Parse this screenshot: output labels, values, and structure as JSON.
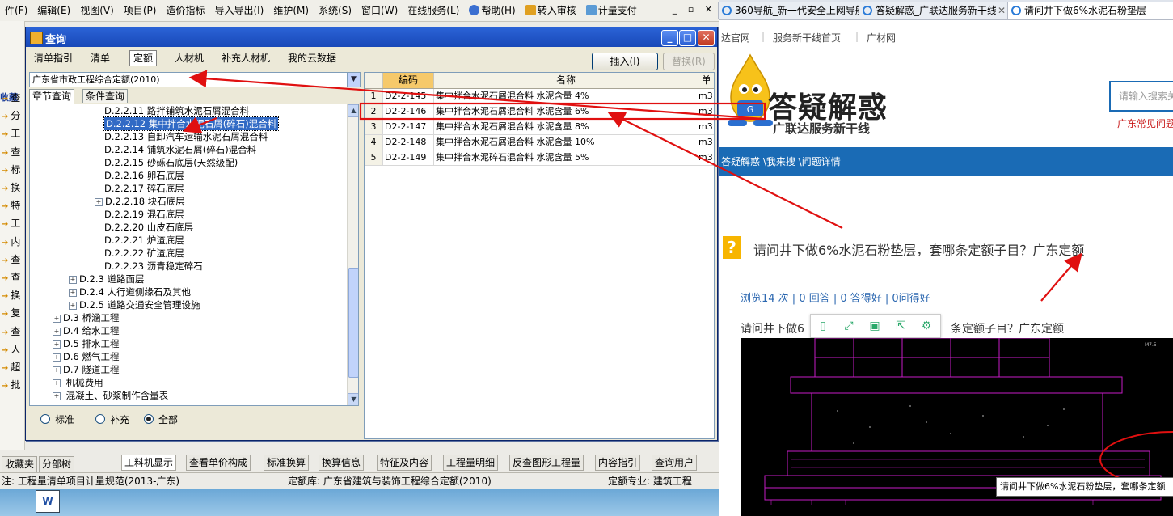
{
  "menubar": {
    "items": [
      "件(F)",
      "编辑(E)",
      "视图(V)",
      "项目(P)",
      "造价指标",
      "导入导出(I)",
      "维护(M)",
      "系统(S)",
      "窗口(W)",
      "在线服务(L)"
    ],
    "help": "帮助(H)",
    "transfer_review": "转入审核",
    "measure_pay": "计量支付",
    "window_controls": "_ ▫ ✕"
  },
  "left_strip": {
    "header": "收藏",
    "rows": [
      "查",
      "分",
      "工",
      "查",
      "标",
      "换",
      "特",
      "工",
      "内",
      "查",
      "查",
      "换",
      "复",
      "查",
      "人",
      "超",
      "批"
    ]
  },
  "dialog": {
    "title": "查询",
    "tabs": [
      "清单指引",
      "清单",
      "定额",
      "人材机",
      "补充人材机",
      "我的云数据"
    ],
    "active_tab": "定额",
    "insert_label": "插入(I)",
    "replace_label": "替换(R)",
    "quota_library": "广东省市政工程综合定额(2010)",
    "subtabs": [
      "章节查询",
      "条件查询"
    ],
    "tree": [
      {
        "code": "D.2.2.11",
        "name": "路拌铺筑水泥石屑混合料",
        "level": 4,
        "expander": false,
        "selected": false
      },
      {
        "code": "D.2.2.12",
        "name": "集中拌合水泥石屑(碎石)混合料",
        "level": 4,
        "expander": false,
        "selected": true
      },
      {
        "code": "D.2.2.13",
        "name": "自卸汽车运输水泥石屑混合料",
        "level": 4,
        "expander": false,
        "selected": false
      },
      {
        "code": "D.2.2.14",
        "name": "铺筑水泥石屑(碎石)混合料",
        "level": 4,
        "expander": false,
        "selected": false
      },
      {
        "code": "D.2.2.15",
        "name": "砂砾石底层(天然级配)",
        "level": 4,
        "expander": false,
        "selected": false
      },
      {
        "code": "D.2.2.16",
        "name": "卵石底层",
        "level": 4,
        "expander": false,
        "selected": false
      },
      {
        "code": "D.2.2.17",
        "name": "碎石底层",
        "level": 4,
        "expander": false,
        "selected": false
      },
      {
        "code": "D.2.2.18",
        "name": "块石底层",
        "level": 4,
        "expander": true,
        "selected": false
      },
      {
        "code": "D.2.2.19",
        "name": "混石底层",
        "level": 4,
        "expander": false,
        "selected": false
      },
      {
        "code": "D.2.2.20",
        "name": "山皮石底层",
        "level": 4,
        "expander": false,
        "selected": false
      },
      {
        "code": "D.2.2.21",
        "name": "炉渣底层",
        "level": 4,
        "expander": false,
        "selected": false
      },
      {
        "code": "D.2.2.22",
        "name": "矿渣底层",
        "level": 4,
        "expander": false,
        "selected": false
      },
      {
        "code": "D.2.2.23",
        "name": "沥青稳定碎石",
        "level": 4,
        "expander": false,
        "selected": false
      },
      {
        "code": "D.2.3",
        "name": "道路面层",
        "level": 2,
        "expander": true,
        "selected": false
      },
      {
        "code": "D.2.4",
        "name": "人行道侧缘石及其他",
        "level": 2,
        "expander": true,
        "selected": false
      },
      {
        "code": "D.2.5",
        "name": "道路交通安全管理设施",
        "level": 2,
        "expander": true,
        "selected": false
      },
      {
        "code": "D.3",
        "name": "桥涵工程",
        "level": 1,
        "expander": true,
        "selected": false
      },
      {
        "code": "D.4",
        "name": "给水工程",
        "level": 1,
        "expander": true,
        "selected": false
      },
      {
        "code": "D.5",
        "name": "排水工程",
        "level": 1,
        "expander": true,
        "selected": false
      },
      {
        "code": "D.6",
        "name": "燃气工程",
        "level": 1,
        "expander": true,
        "selected": false
      },
      {
        "code": "D.7",
        "name": "隧道工程",
        "level": 1,
        "expander": true,
        "selected": false
      },
      {
        "code": "",
        "name": "机械费用",
        "level": 1,
        "expander": true,
        "selected": false
      },
      {
        "code": "",
        "name": "混凝土、砂浆制作含量表",
        "level": 1,
        "expander": true,
        "selected": false
      }
    ],
    "radios": [
      {
        "label": "标准",
        "checked": false
      },
      {
        "label": "补充",
        "checked": false
      },
      {
        "label": "全部",
        "checked": true
      }
    ],
    "grid": {
      "columns": [
        "",
        "编码",
        "名称",
        "单"
      ],
      "rows": [
        {
          "n": "1",
          "code": "D2-2-145",
          "name": "集中拌合水泥石屑混合料 水泥含量 4%",
          "unit": "m3"
        },
        {
          "n": "2",
          "code": "D2-2-146",
          "name": "集中拌合水泥石屑混合料 水泥含量 6%",
          "unit": "m3"
        },
        {
          "n": "3",
          "code": "D2-2-147",
          "name": "集中拌合水泥石屑混合料 水泥含量 8%",
          "unit": "m3"
        },
        {
          "n": "4",
          "code": "D2-2-148",
          "name": "集中拌合水泥石屑混合料 水泥含量 10%",
          "unit": "m3"
        },
        {
          "n": "5",
          "code": "D2-2-149",
          "name": "集中拌合水泥碎石混合料 水泥含量 5%",
          "unit": "m3"
        }
      ]
    }
  },
  "bottom_tabs": {
    "left": [
      "收藏夹",
      "分部树"
    ],
    "right": [
      "工料机显示",
      "查看单价构成",
      "标准换算",
      "换算信息",
      "特征及内容",
      "工程量明细",
      "反查图形工程量",
      "内容指引",
      "查询用户"
    ]
  },
  "status": {
    "spec": "注: 工程量清单项目计量规范(2013-广东)",
    "library": "定额库: 广东省建筑与装饰工程综合定额(2010)",
    "major": "定额专业: 建筑工程"
  },
  "desktop_icon": "W",
  "browser": {
    "tabs": [
      {
        "label": "360导航_新一代安全上网导航",
        "active": false
      },
      {
        "label": "答疑解惑_广联达服务新干线",
        "active": false
      },
      {
        "label": "请问井下做6%水泥石粉垫层",
        "active": true
      }
    ],
    "topnav": [
      "达官网",
      "服务新干线首页",
      "广材网"
    ],
    "logo_badge": "G",
    "logo_title": "答疑解惑",
    "logo_sub": "广联达服务新干线",
    "search_placeholder": "请输入搜索关",
    "search_hint": "广东常见问题",
    "breadcrumb": "答疑解惑 \\我来搜 \\问题详情",
    "question_mark": "?",
    "question_title": "请问井下做6%水泥石粉垫层，套哪条定额子目？广东定额",
    "stats": "浏览14 次 | 0 回答 | 0 答得好 | 0问得好",
    "body_left": "请问井下做6",
    "body_right": "条定额子目？广东定额",
    "cad_labels": [
      "M7.5"
    ],
    "tooltip": "请问井下做6%水泥石粉垫层，套哪条定额"
  },
  "colors": {
    "title_bar": "#2b63d6",
    "selection": "#316ac5",
    "annotation": "#e01010",
    "browser_blue": "#1a6bb5",
    "cad_magenta": "#c61cc6"
  }
}
